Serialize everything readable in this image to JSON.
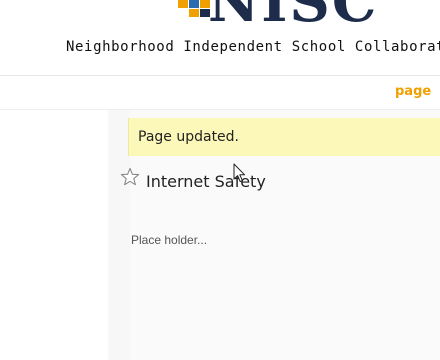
{
  "header": {
    "logo_text": "NISC",
    "org_name": "Neighborhood Independent School Collaborat",
    "logo_colors": [
      "#f0a000",
      "#2b6cb0",
      "#f0a000",
      "#1c2c4a"
    ]
  },
  "nav": {
    "page_link": "page",
    "accent_color": "#f0a000"
  },
  "notice": {
    "message": "Page updated.",
    "background": "#fbf8b9"
  },
  "page": {
    "title": "Internet Safety",
    "body_text": "Place holder...",
    "star_icon": "star-outline-icon"
  },
  "cursor": {
    "icon": "mouse-pointer-icon"
  }
}
